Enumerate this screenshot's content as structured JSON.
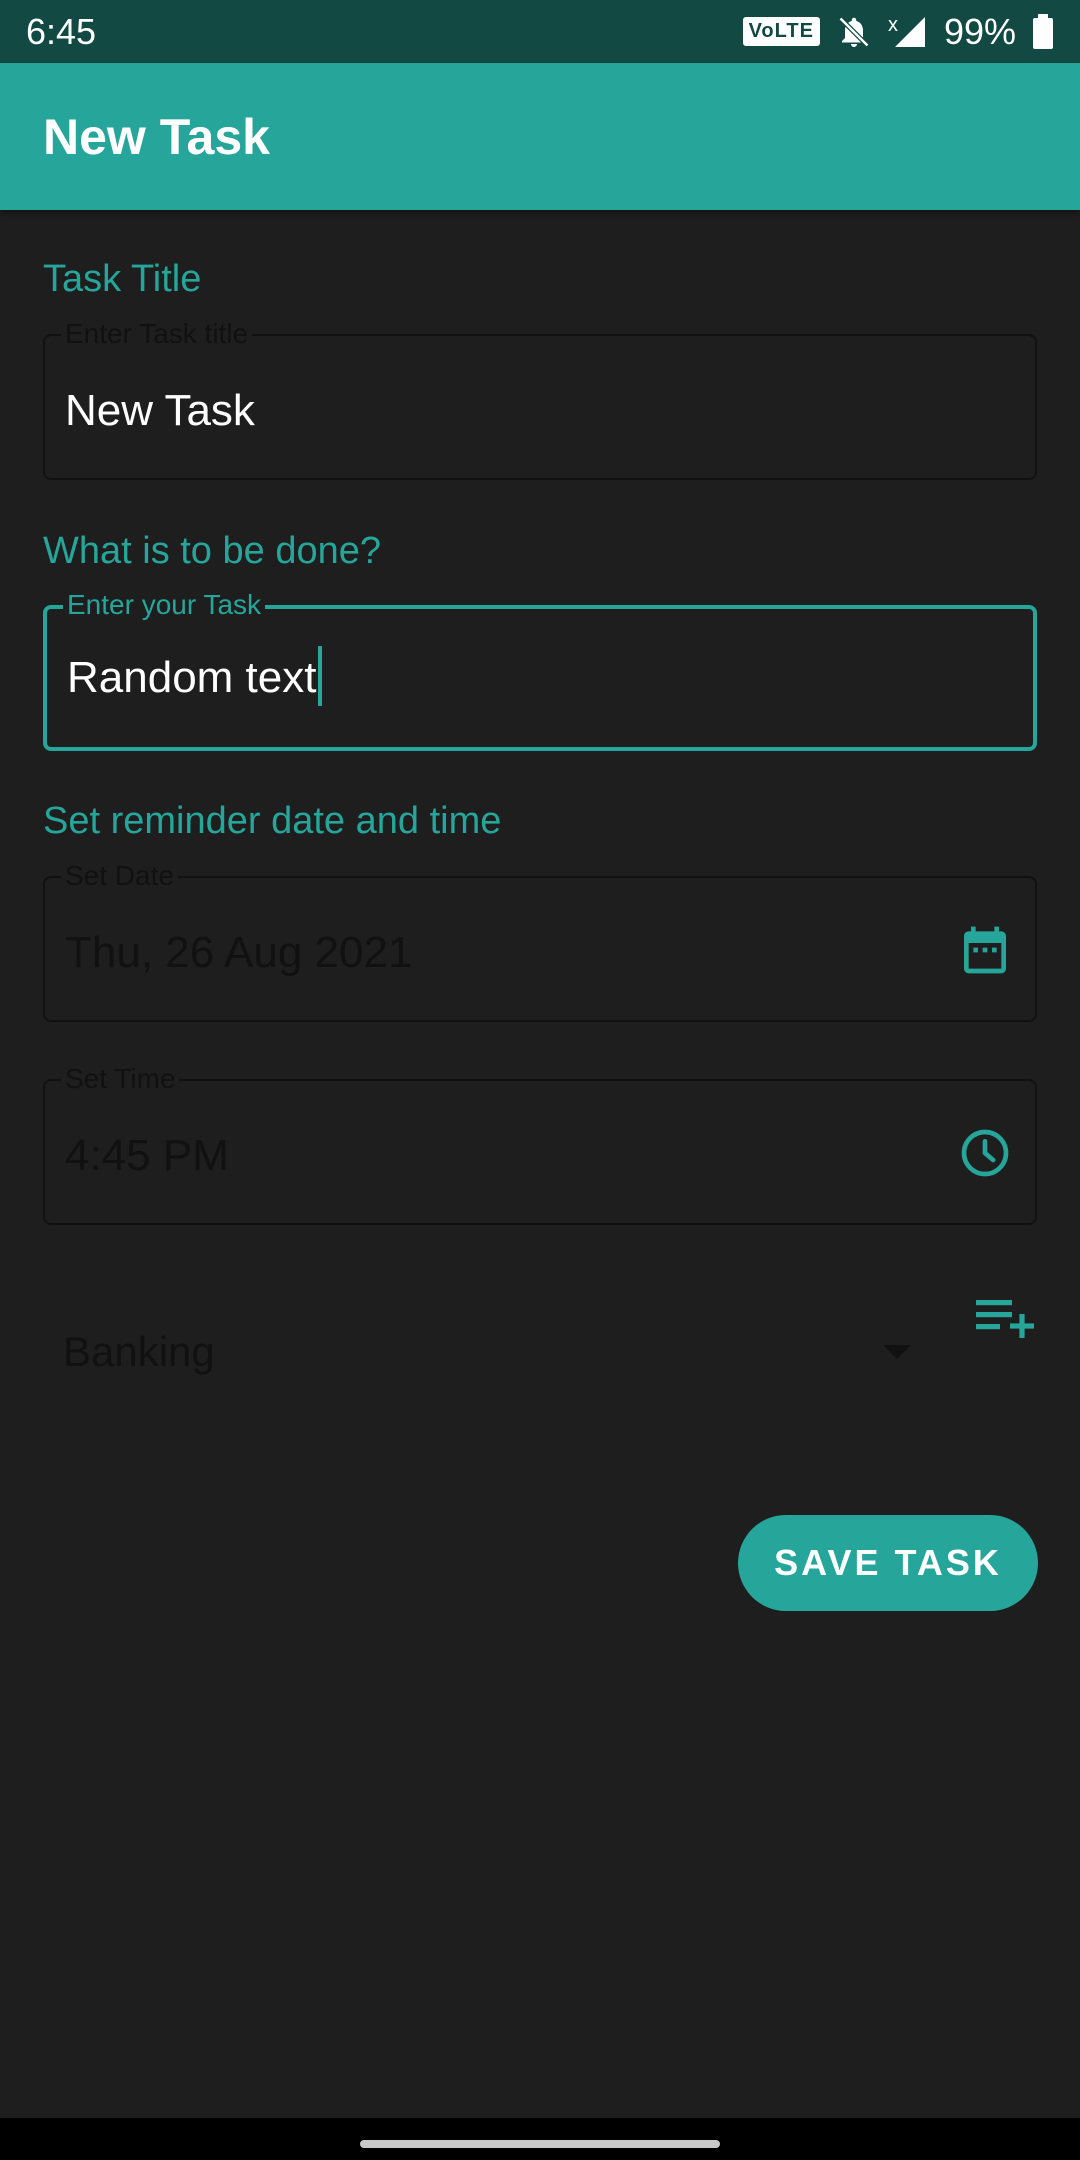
{
  "status_bar": {
    "time": "6:45",
    "network_badge": "VoLTE",
    "signal_marker": "x",
    "battery": "99%",
    "icons": [
      "bell-off-icon",
      "signal-icon",
      "battery-icon"
    ]
  },
  "app_bar": {
    "title": "New Task"
  },
  "form": {
    "title_section": {
      "label": "Task Title",
      "legend": "Enter Task title",
      "value": "New Task"
    },
    "task_section": {
      "label": "What is to be done?",
      "legend": "Enter your Task",
      "value": "Random text"
    },
    "reminder_section": {
      "label": "Set reminder date and time",
      "date_legend": "Set Date",
      "date_value": "Thu, 26 Aug 2021",
      "date_icon": "calendar-icon",
      "time_legend": "Set Time",
      "time_value": "4:45 PM",
      "time_icon": "clock-icon"
    },
    "category": {
      "selected": "Banking",
      "add_icon": "playlist-add-icon"
    },
    "save_label": "SAVE TASK"
  },
  "colors": {
    "accent": "#26a69a",
    "status_bar": "#124a43",
    "background": "#1e1e1e"
  }
}
